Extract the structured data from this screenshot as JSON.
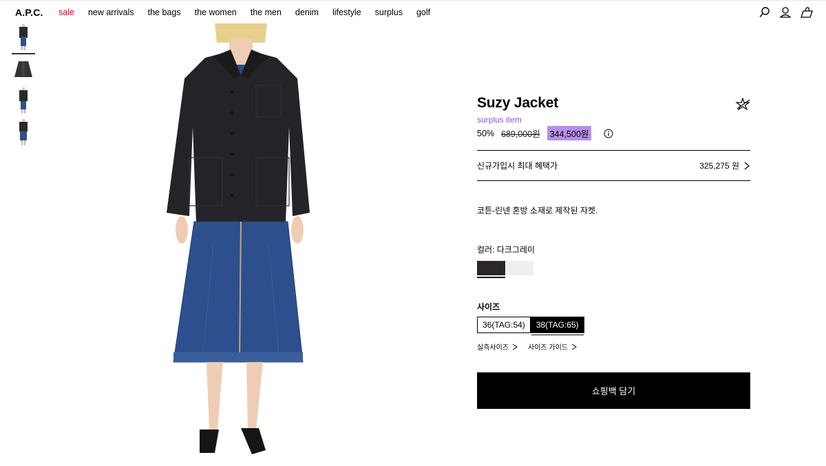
{
  "header": {
    "logo": "A.P.C.",
    "nav": [
      "sale",
      "new arrivals",
      "the bags",
      "the women",
      "the men",
      "denim",
      "lifestyle",
      "surplus",
      "golf"
    ]
  },
  "icons": [
    "search-icon",
    "account-icon",
    "shopping-bag-icon"
  ],
  "product": {
    "title": "Suzy Jacket",
    "tag": "surplus item",
    "discount": "50%",
    "original_price": "689,000원",
    "sale_price": "344,500원",
    "benefit_label": "신규가입시 최대 혜택가",
    "benefit_price": "325,275 원",
    "description": "코튼-린넨 혼방 소재로 제작된 자켓.",
    "color_label": "컬러: 다크그레이",
    "colors": [
      "#2b2728",
      "#efefed"
    ],
    "size_label": "사이즈",
    "sizes": [
      "36(TAG:54)",
      "38(TAG:65)"
    ],
    "selected_size": "38(TAG:65)",
    "size_links": [
      "실측사이즈",
      "사이즈 가이드"
    ],
    "cart_button": "쇼핑백 담기"
  },
  "colors": {
    "accent_sale": "#d1001c",
    "surplus": "#8a55d8",
    "highlight": "#b58fe8"
  }
}
